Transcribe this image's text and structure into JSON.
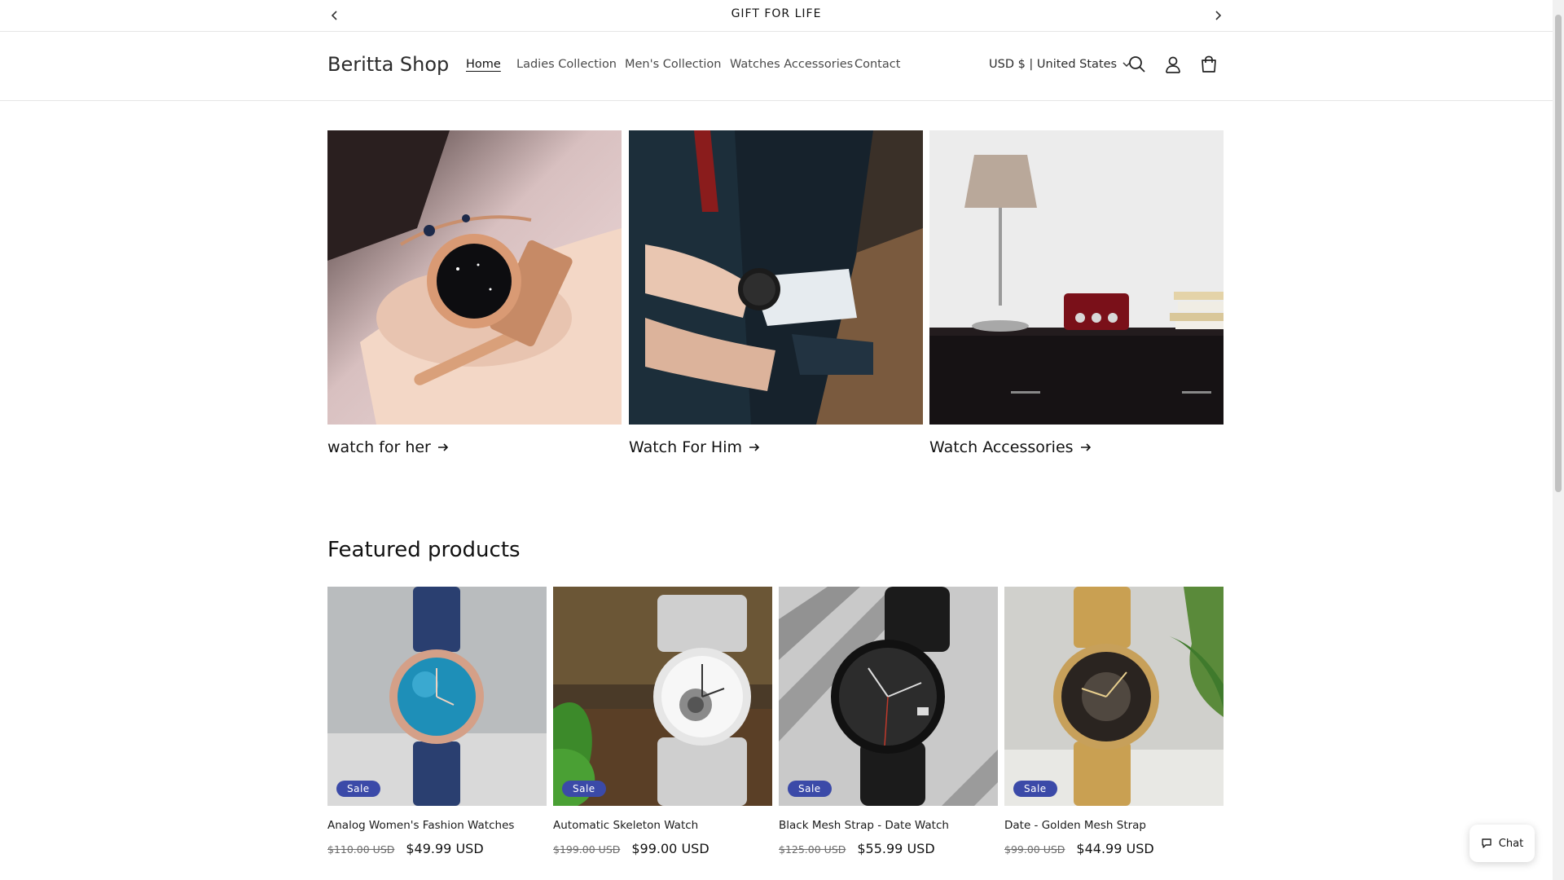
{
  "announcement": {
    "text": "GIFT FOR LIFE"
  },
  "header": {
    "brand": "Beritta Shop",
    "nav": [
      "Home",
      "Ladies Collection",
      "Men's Collection",
      "Watches Accessories",
      "Contact"
    ],
    "active_nav": "Home",
    "currency": "USD $ | United States",
    "icons": [
      "search-icon",
      "account-icon",
      "cart-icon"
    ]
  },
  "collections": [
    {
      "label": "watch for her"
    },
    {
      "label": "Watch For Him"
    },
    {
      "label": "Watch Accessories"
    }
  ],
  "featured": {
    "title": "Featured products",
    "products": [
      {
        "name": "Analog Women's Fashion Watches",
        "badge": "Sale",
        "old_price": "$110.00 USD",
        "price": "$49.99 USD"
      },
      {
        "name": "Automatic Skeleton Watch",
        "badge": "Sale",
        "old_price": "$199.00 USD",
        "price": "$99.00 USD"
      },
      {
        "name": "Black Mesh Strap - Date Watch",
        "badge": "Sale",
        "old_price": "$125.00 USD",
        "price": "$55.99 USD"
      },
      {
        "name": "Date - Golden Mesh Strap",
        "badge": "Sale",
        "old_price": "$99.00 USD",
        "price": "$44.99 USD"
      }
    ]
  },
  "chat": {
    "label": "Chat"
  },
  "colors": {
    "sale_badge": "#3b4aa8",
    "text": "#121212",
    "muted": "#6b6b6b"
  }
}
